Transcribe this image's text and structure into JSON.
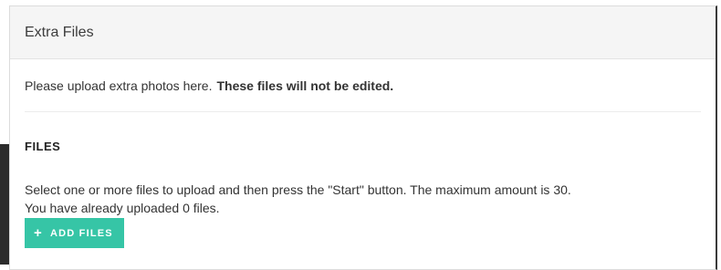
{
  "panel": {
    "title": "Extra Files"
  },
  "intro": {
    "text": "Please upload extra photos here.",
    "strong": "These files will not be edited."
  },
  "files": {
    "heading": "FILES",
    "instruction": "Select one or more files to upload and then press the \"Start\" button. The maximum amount is 30.",
    "status": "You have already uploaded 0 files.",
    "add_button": {
      "icon": "plus-icon",
      "label": "ADD FILES"
    }
  },
  "colors": {
    "accent": "#36c5a6",
    "header_bg": "#f5f5f5"
  }
}
